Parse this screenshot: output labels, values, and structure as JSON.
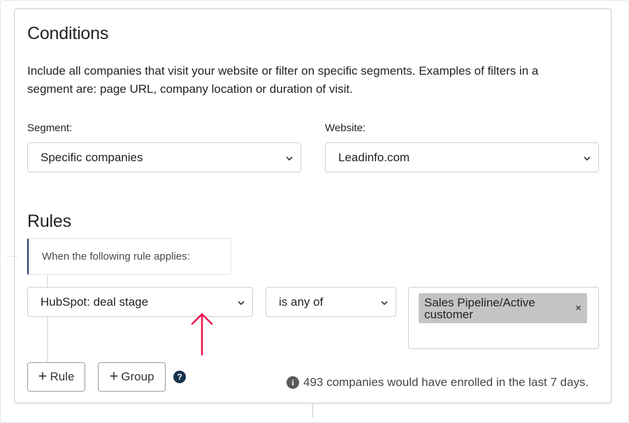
{
  "conditions": {
    "title": "Conditions",
    "description": "Include all companies that visit your website or filter on specific segments. Examples of filters in a segment are: page URL, company location or duration of visit.",
    "segment": {
      "label": "Segment:",
      "value": "Specific companies"
    },
    "website": {
      "label": "Website:",
      "value": "Leadinfo.com"
    }
  },
  "rules": {
    "title": "Rules",
    "applies_text": "When the following rule applies:",
    "field": {
      "value": "HubSpot: deal stage"
    },
    "operator": {
      "value": "is any of"
    },
    "tags": [
      {
        "label": "Sales Pipeline/Active customer",
        "remove": "×"
      }
    ],
    "add_rule_label": "Rule",
    "add_group_label": "Group",
    "help_glyph": "?",
    "info_glyph": "i",
    "enrollment_text": "493 companies would have enrolled in the last 7 days."
  },
  "icons": {
    "chevron": "chevron-down-icon",
    "plus": "plus-icon",
    "help": "question-circle-icon",
    "info": "info-circle-icon",
    "annotation": "arrow-up-icon"
  },
  "colors": {
    "annotation_arrow": "#e8194f",
    "help_icon": "#17324d",
    "tag_background": "#c4c4c4",
    "rule_accent": "#1c3a5f"
  }
}
